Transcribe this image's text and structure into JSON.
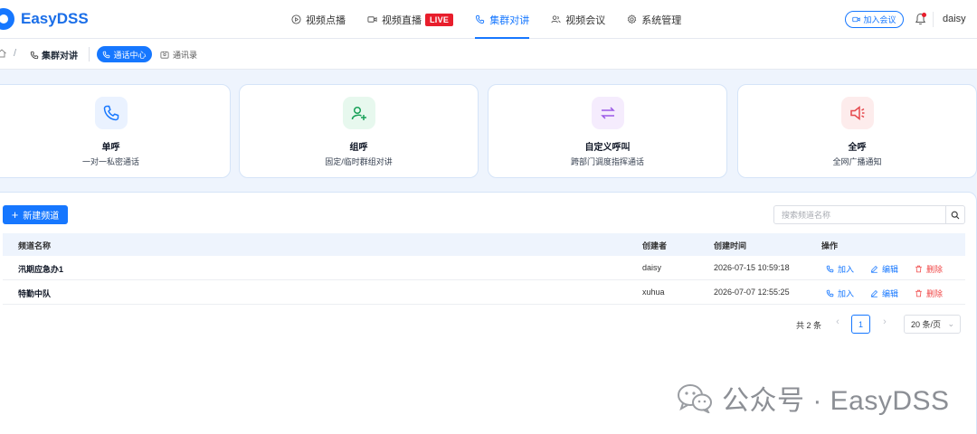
{
  "app": {
    "title": "EasyDSS",
    "accent": "#1677ff"
  },
  "nav": {
    "items": [
      {
        "label": "视频点播",
        "icon": "play-circle-icon"
      },
      {
        "label": "视频直播",
        "icon": "video-camera-icon",
        "badge": "LIVE"
      },
      {
        "label": "集群对讲",
        "icon": "phone-icon",
        "active": true
      },
      {
        "label": "视频会议",
        "icon": "meeting-icon"
      },
      {
        "label": "系统管理",
        "icon": "gear-icon"
      }
    ],
    "join_meeting": "加入会议",
    "user": "daisy"
  },
  "breadcrumb": {
    "section": "集群对讲",
    "tabs": [
      {
        "label": "通话中心",
        "active": true
      },
      {
        "label": "通讯录",
        "active": false
      }
    ]
  },
  "cards": [
    {
      "title": "单呼",
      "subtitle": "一对一私密通话",
      "icon": "phone-icon"
    },
    {
      "title": "组呼",
      "subtitle": "固定/临时群组对讲",
      "icon": "group-add-icon"
    },
    {
      "title": "自定义呼叫",
      "subtitle": "跨部门调度指挥通话",
      "icon": "swap-arrows-icon"
    },
    {
      "title": "全呼",
      "subtitle": "全网广播通知",
      "icon": "megaphone-icon"
    }
  ],
  "toolbar": {
    "new_channel": "新建频道",
    "search_placeholder": "搜索频道名称"
  },
  "table": {
    "columns": [
      "频道名称",
      "创建者",
      "创建时间",
      "操作"
    ],
    "rows": [
      {
        "name": "汛期应急办1",
        "creator": "daisy",
        "created": "2026-07-15 10:59:18"
      },
      {
        "name": "特勤中队",
        "creator": "xuhua",
        "created": "2026-07-07 12:55:25"
      }
    ],
    "actions": {
      "join": "加入",
      "edit": "编辑",
      "delete": "删除"
    }
  },
  "pagination": {
    "total": "共 2 条",
    "page": "1",
    "page_size": "20 条/页"
  },
  "watermark": {
    "text": "公众号 · EasyDSS"
  }
}
